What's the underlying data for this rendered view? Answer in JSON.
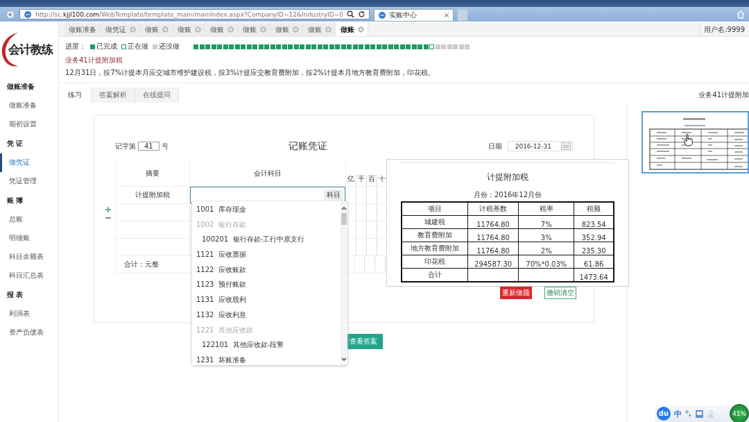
{
  "browser": {
    "url": "http://sc.**kjjl100.com**/WebTemplate/template_main/mainIndex.aspx?CompanyID=12&IndustryID=0",
    "tab_title": "实账中心"
  },
  "logo": "会计教练",
  "sidebar": [
    {
      "label": "做账准备",
      "items": [
        {
          "label": "做账准备",
          "selected": false
        },
        {
          "label": "期初设置",
          "selected": false
        }
      ]
    },
    {
      "label": "凭 证",
      "items": [
        {
          "label": "做凭证",
          "selected": true
        },
        {
          "label": "凭证管理",
          "selected": false
        }
      ]
    },
    {
      "label": "账 簿",
      "items": [
        {
          "label": "总账",
          "selected": false
        },
        {
          "label": "明细账",
          "selected": false
        },
        {
          "label": "科目余额表",
          "selected": false
        },
        {
          "label": "科目汇总表",
          "selected": false
        }
      ]
    },
    {
      "label": "报 表",
      "items": [
        {
          "label": "利润表",
          "selected": false
        },
        {
          "label": "资产负债表",
          "selected": false
        }
      ]
    }
  ],
  "tabs": [
    {
      "label": "做账准备",
      "closable": false,
      "selected": false
    },
    {
      "label": "做凭证",
      "closable": true,
      "selected": false
    },
    {
      "label": "做账",
      "closable": true,
      "selected": false
    },
    {
      "label": "做账",
      "closable": true,
      "selected": false
    },
    {
      "label": "做账",
      "closable": true,
      "selected": false
    },
    {
      "label": "做账",
      "closable": true,
      "selected": false
    },
    {
      "label": "做账",
      "closable": true,
      "selected": false
    },
    {
      "label": "做账",
      "closable": true,
      "selected": false
    },
    {
      "label": "做账",
      "closable": true,
      "selected": true
    }
  ],
  "user": "用户名:9999",
  "progress": {
    "label": "进度：",
    "legend": [
      {
        "kind": "done",
        "label": "已完成"
      },
      {
        "kind": "current",
        "label": "正在做"
      },
      {
        "kind": "todo",
        "label": "还没做"
      }
    ],
    "steps": [
      {
        "done": true,
        "current": false
      },
      {
        "done": true,
        "current": false
      },
      {
        "done": true,
        "current": false
      },
      {
        "done": true,
        "current": false
      },
      {
        "done": true,
        "current": false
      },
      {
        "done": true,
        "current": false
      },
      {
        "done": true,
        "current": false
      },
      {
        "done": true,
        "current": false
      },
      {
        "done": true,
        "current": false
      },
      {
        "done": true,
        "current": false
      },
      {
        "done": true,
        "current": false
      },
      {
        "done": true,
        "current": false
      },
      {
        "done": true,
        "current": false
      },
      {
        "done": true,
        "current": false
      },
      {
        "done": true,
        "current": false
      },
      {
        "done": true,
        "current": false
      },
      {
        "done": true,
        "current": false
      },
      {
        "done": true,
        "current": false
      },
      {
        "done": true,
        "current": false
      },
      {
        "done": true,
        "current": false
      },
      {
        "done": true,
        "current": false
      },
      {
        "done": true,
        "current": false
      },
      {
        "done": true,
        "current": false
      },
      {
        "done": true,
        "current": false
      },
      {
        "done": true,
        "current": false
      },
      {
        "done": true,
        "current": false
      },
      {
        "done": true,
        "current": false
      },
      {
        "done": true,
        "current": false
      },
      {
        "done": true,
        "current": false
      },
      {
        "done": true,
        "current": false
      },
      {
        "done": true,
        "current": false
      },
      {
        "done": true,
        "current": false
      },
      {
        "done": true,
        "current": false
      },
      {
        "done": true,
        "current": false
      },
      {
        "done": true,
        "current": false
      },
      {
        "done": true,
        "current": false
      },
      {
        "done": true,
        "current": false
      },
      {
        "done": true,
        "current": false
      },
      {
        "done": true,
        "current": false
      },
      {
        "done": true,
        "current": false
      },
      {
        "done": false,
        "current": true
      },
      {
        "done": false,
        "current": false
      },
      {
        "done": false,
        "current": false
      },
      {
        "done": false,
        "current": false
      },
      {
        "done": false,
        "current": false
      },
      {
        "done": false,
        "current": false
      },
      {
        "done": false,
        "current": false
      }
    ]
  },
  "task": {
    "title": "业务41计提附加税",
    "description": "12月31日，按7%计提本月应交城市维护建设税，按3%计提应交教育费附加，按2%计提本月地方教育费附加，印花税。"
  },
  "subtabs": [
    {
      "label": "练习",
      "selected": true
    },
    {
      "label": "答案解析",
      "selected": false
    },
    {
      "label": "在线提问",
      "selected": false
    }
  ],
  "side_title": "业务41计提附加",
  "voucher": {
    "number_prefix": "记字第",
    "number": "41",
    "number_suffix": "号",
    "title": "记账凭证",
    "date_label": "日期",
    "date": "2016-12-31",
    "columns": [
      "摘要",
      "会计科目"
    ],
    "digit_headers": [
      "亿",
      "千",
      "百",
      "十"
    ],
    "entry": {
      "summary": "计提附加税",
      "account_button": "科目"
    },
    "total_label": "合计：元整",
    "buttons": [
      {
        "label": "重新做题",
        "kind": "danger"
      },
      {
        "label": "撤销清空",
        "kind": "outline"
      }
    ]
  },
  "account_dropdown": [
    {
      "code": "1001",
      "name": "库存现金",
      "disabled": false
    },
    {
      "code": "1002",
      "name": "银行存款",
      "disabled": true,
      "children": [
        {
          "code": "100201",
          "name": "银行存款-工行中原支行",
          "disabled": false
        }
      ]
    },
    {
      "code": "1121",
      "name": "应收票据",
      "disabled": false
    },
    {
      "code": "1122",
      "name": "应收账款",
      "disabled": false
    },
    {
      "code": "1123",
      "name": "预付账款",
      "disabled": false
    },
    {
      "code": "1131",
      "name": "应收股利",
      "disabled": false
    },
    {
      "code": "1132",
      "name": "应收利息",
      "disabled": false
    },
    {
      "code": "1221",
      "name": "其他应收款",
      "disabled": true,
      "children": [
        {
          "code": "122101",
          "name": "其他应收款-段警",
          "disabled": false
        }
      ]
    },
    {
      "code": "1231",
      "name": "坏账准备",
      "disabled": false
    }
  ],
  "answer_button": "查看答案",
  "tax_popup": {
    "title": "计提附加税",
    "month": "月份：2016年12月份",
    "columns": [
      "项目",
      "计税基数",
      "税率",
      "税额"
    ],
    "rows": [
      {
        "item": "城建税",
        "base": "11764.80",
        "rate": "7%",
        "tax": "823.54"
      },
      {
        "item": "教育费附加",
        "base": "11764.80",
        "rate": "3%",
        "tax": "352.94"
      },
      {
        "item": "地方教育费附加",
        "base": "11764.80",
        "rate": "2%",
        "tax": "235.30"
      },
      {
        "item": "印花税",
        "base": "294587.30",
        "rate": "70%*0.03%",
        "tax": "61.86"
      },
      {
        "item": "合计",
        "tax": "1473.64"
      }
    ]
  },
  "ime": {
    "logo": "du",
    "mode": "中",
    "meter": "41%"
  }
}
